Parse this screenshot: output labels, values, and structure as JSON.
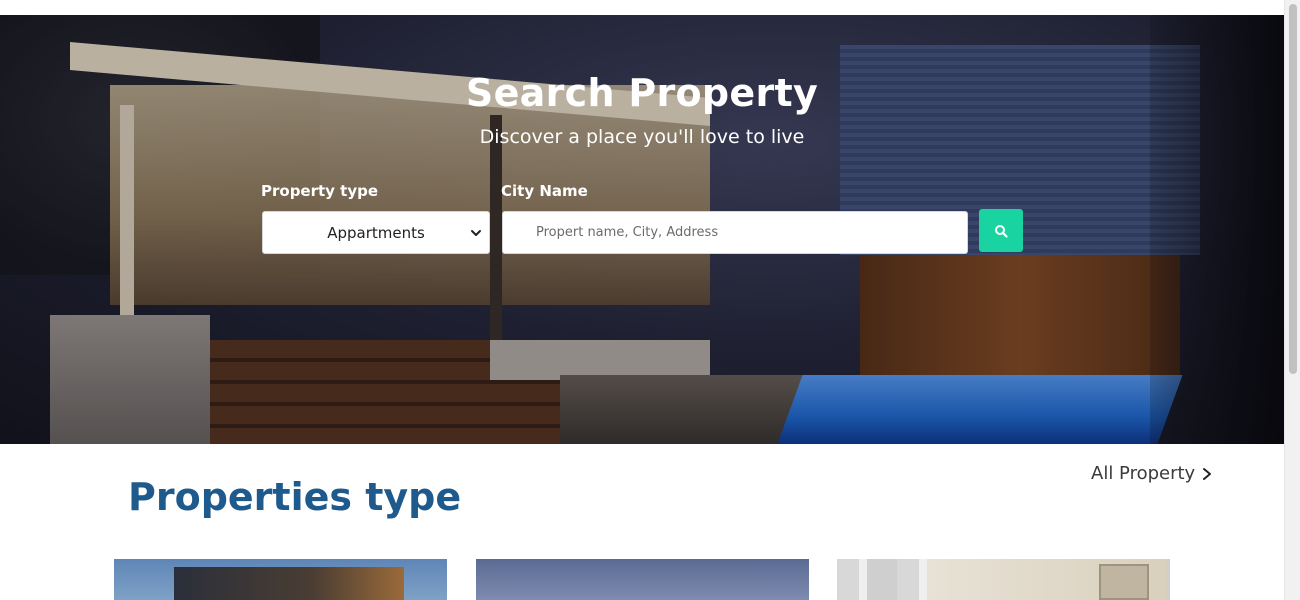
{
  "hero": {
    "title": "Search Property",
    "subtitle": "Discover a place you'll love to live",
    "property_type_label": "Property type",
    "city_label": "City Name",
    "property_type_value": "Appartments",
    "city_placeholder": "Propert name, City, Address",
    "search_icon": "search-icon"
  },
  "section": {
    "title": "Properties type",
    "all_property_label": "All Property",
    "all_property_icon": "chevron-right-icon"
  },
  "colors": {
    "accent": "#19d3a1",
    "title_blue": "#1f5a8c"
  }
}
